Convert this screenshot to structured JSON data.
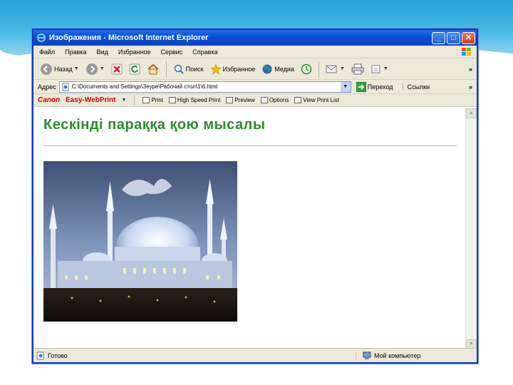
{
  "window": {
    "title": "Изображения - Microsoft Internet Explorer",
    "minimize_label": "_",
    "maximize_label": "□",
    "close_label": "✕"
  },
  "menubar": {
    "items": [
      "Файл",
      "Правка",
      "Вид",
      "Избранное",
      "Сервис",
      "Справка"
    ]
  },
  "toolbar": {
    "back_label": "Назад",
    "search_label": "Поиск",
    "favorites_label": "Избранное",
    "media_label": "Медиа",
    "more_label": "»"
  },
  "addressbar": {
    "label": "Адрес",
    "value": "C:\\Documents and Settings\\Зеуре\\Рабочий стол\\1\\6.html",
    "go_label": "Переход",
    "links_label": "Ссылки",
    "more_label": "»"
  },
  "canonbar": {
    "canon_label": "Canon",
    "easy_label": "Easy-WebPrint",
    "print_label": "Print",
    "hsp_label": "High Speed Print",
    "preview_label": "Preview",
    "options_label": "Options",
    "viewlist_label": "View Print List"
  },
  "page": {
    "heading": "Кескінді параққа қою мысалы"
  },
  "statusbar": {
    "status_text": "Готово",
    "zone_text": "Мой компьютер"
  },
  "colors": {
    "heading": "#2e8b2e",
    "titlebar": "#0b4fd6",
    "chrome": "#ece9d8",
    "slide_accent": "#29a3d6"
  }
}
